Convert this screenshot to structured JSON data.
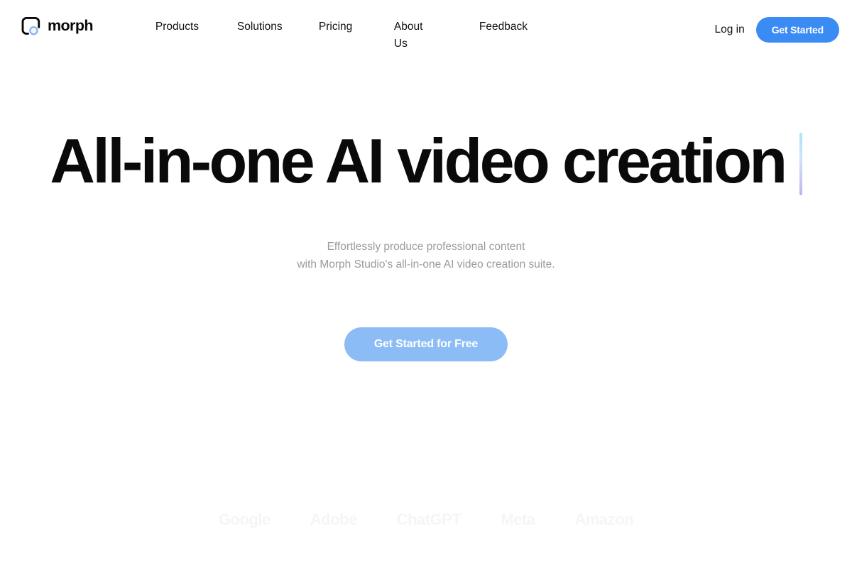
{
  "header": {
    "brand": {
      "name": "morph",
      "mark_icon": "morph-logo-icon"
    },
    "nav_items": [
      {
        "label": "Products"
      },
      {
        "label": "Solutions"
      },
      {
        "label": "Pricing"
      },
      {
        "label": "About Us"
      },
      {
        "label": "Feedback"
      }
    ],
    "login_label": "Log in",
    "get_started_label": "Get Started"
  },
  "hero": {
    "title_line1": "All-in-one AI video",
    "title_line2": "creation",
    "caret_icon": "text-caret",
    "subtitle_line1": "Effortlessly produce professional content",
    "subtitle_line2": "with Morph Studio's all-in-one AI video creation suite.",
    "cta_label": "Get Started for Free"
  },
  "partners": {
    "logos": [
      {
        "label": "Google"
      },
      {
        "label": "Adobe"
      },
      {
        "label": "ChatGPT"
      },
      {
        "label": "Meta"
      },
      {
        "label": "Amazon"
      }
    ]
  },
  "colors": {
    "accent_blue": "#3b8bf5",
    "cta_blue": "#8cbcf6",
    "text_dark": "#0a0a0a",
    "text_muted": "#9b9b9b",
    "caret_top": "#a9e6f7",
    "caret_bottom": "#bdb4f0",
    "background": "#ffffff"
  }
}
